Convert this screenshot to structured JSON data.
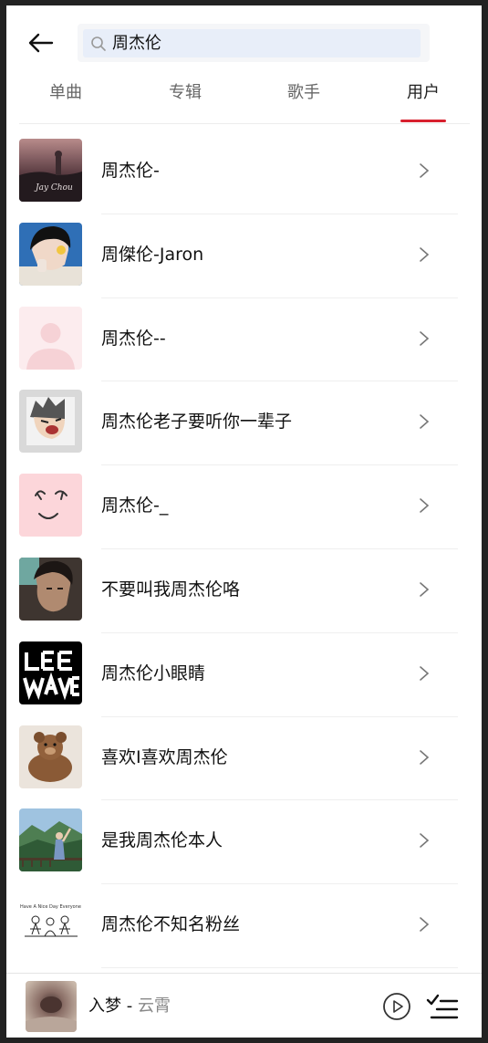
{
  "search": {
    "query": "周杰伦"
  },
  "tabs": [
    {
      "label": "单曲",
      "active": false
    },
    {
      "label": "专辑",
      "active": false
    },
    {
      "label": "歌手",
      "active": false
    },
    {
      "label": "用户",
      "active": true
    }
  ],
  "users": [
    {
      "name": "周杰伦-",
      "avatar": "jay-chou-album-cover"
    },
    {
      "name": "周傑伦-Jaron",
      "avatar": "anime-boy-blue-background"
    },
    {
      "name": "周杰伦--",
      "avatar": "default-avatar"
    },
    {
      "name": "周杰伦老子要听你一辈子",
      "avatar": "anime-character-shouting"
    },
    {
      "name": "周杰伦-_",
      "avatar": "smiley-face-doodle-pink"
    },
    {
      "name": "不要叫我周杰伦咯",
      "avatar": "man-portrait-photo"
    },
    {
      "name": "周杰伦小眼睛",
      "avatar": "lee-wave-logo"
    },
    {
      "name": "喜欢I喜欢周杰伦",
      "avatar": "teddy-bear-photo"
    },
    {
      "name": "是我周杰伦本人",
      "avatar": "girl-on-mountain-photo"
    },
    {
      "name": "周杰伦不知名粉丝",
      "avatar": "have-a-nice-day-everyone-doodle"
    }
  ],
  "player": {
    "song": "入梦",
    "separator": " - ",
    "artist": "云霄"
  },
  "colors": {
    "accent": "#d8202e",
    "search_fill": "#e8eef9"
  }
}
